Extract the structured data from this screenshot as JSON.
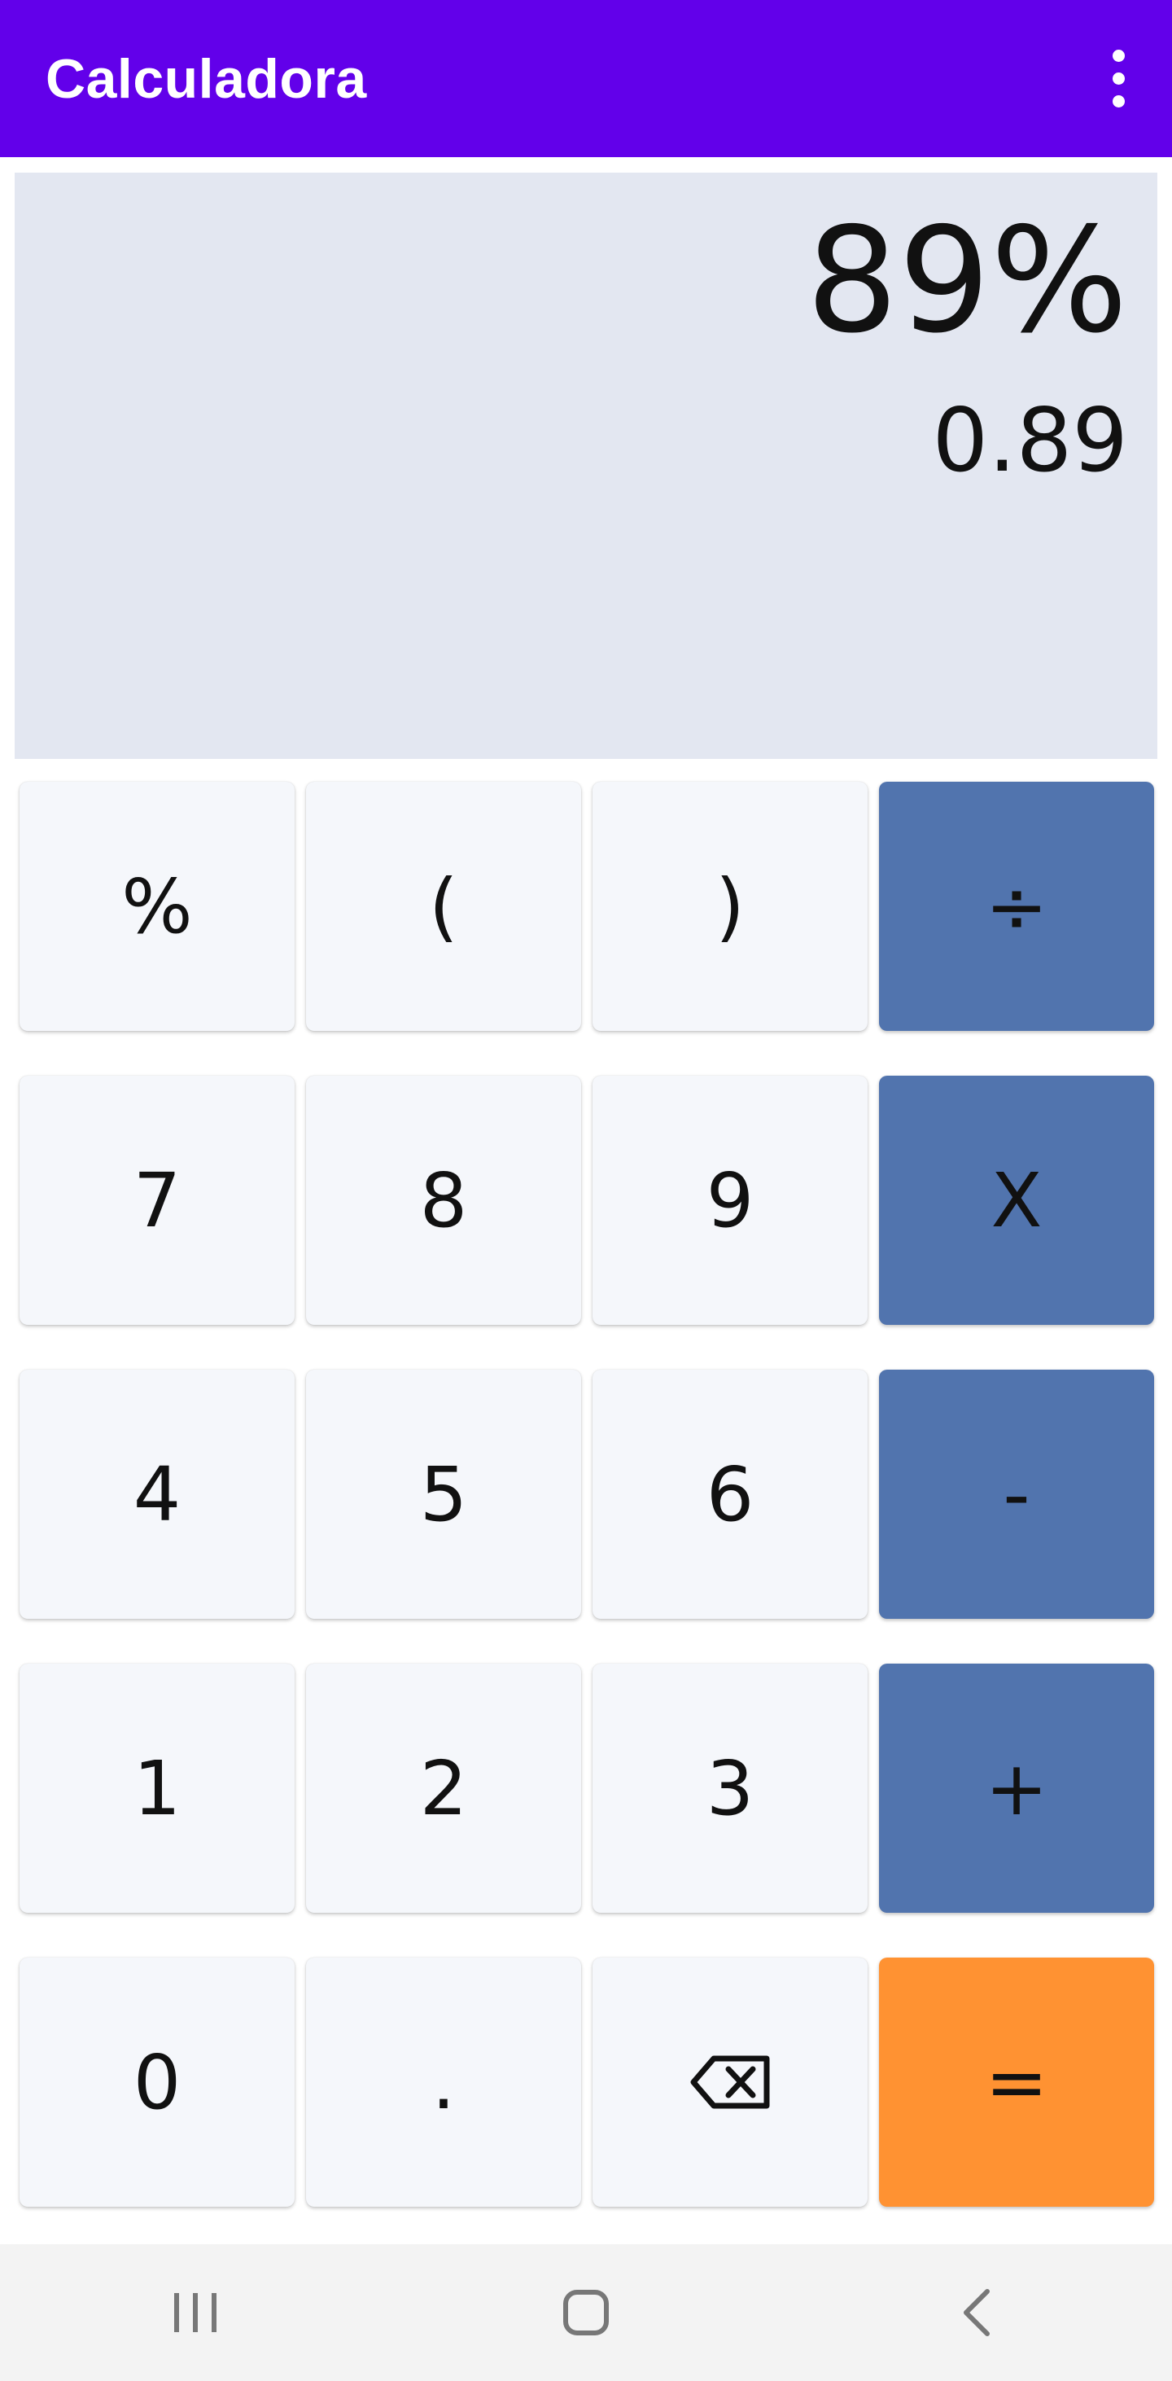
{
  "app": {
    "title": "Calculadora",
    "accent_color": "#6200ea"
  },
  "display": {
    "expression": "89%",
    "result": "0.89"
  },
  "keypad": {
    "row1": {
      "k1": "%",
      "k2": "(",
      "k3": ")",
      "k4": "÷"
    },
    "row2": {
      "k1": "7",
      "k2": "8",
      "k3": "9",
      "k4": "X"
    },
    "row3": {
      "k1": "4",
      "k2": "5",
      "k3": "6",
      "k4": "-"
    },
    "row4": {
      "k1": "1",
      "k2": "2",
      "k3": "3",
      "k4": "+"
    },
    "row5": {
      "k1": "0",
      "k2": ".",
      "k3_icon": "backspace-icon",
      "k4": "="
    },
    "colors": {
      "digit_key": "#f5f7fb",
      "operator_key": "#5174ae",
      "equals_key": "#ff9232"
    }
  },
  "navbar": {
    "recent_icon": "recent-apps-icon",
    "home_icon": "home-icon",
    "back_icon": "back-icon"
  }
}
